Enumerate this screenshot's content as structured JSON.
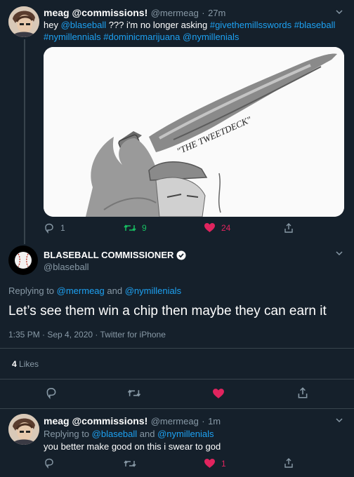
{
  "tweet1": {
    "name": "meag @commissions!",
    "handle": "@mermeag",
    "sep": "·",
    "time": "27m",
    "text_parts": [
      "hey ",
      "@blaseball",
      " ??? i'm no longer asking ",
      "#givethemillsswords",
      " ",
      "#blaseball",
      " ",
      "#nymillennials",
      " ",
      "#dominicmarijuana",
      " ",
      "@nymillenials"
    ],
    "image_caption": "\"THE TWEETDECK\"",
    "replies": "1",
    "retweets": "9",
    "likes": "24"
  },
  "main_tweet": {
    "name": "BLASEBALL COMMISSIONER",
    "handle": "@blaseball",
    "replying_prefix": "Replying to ",
    "replying_user1": "@mermeag",
    "replying_and": " and ",
    "replying_user2": "@nymillenials",
    "text": "Let’s see them win a chip then maybe they can earn it",
    "meta": "1:35 PM · Sep 4, 2020 · Twitter for iPhone",
    "likes_count": "4",
    "likes_label": " Likes"
  },
  "reply_tweet": {
    "name": "meag @commissions!",
    "handle": "@mermeag",
    "sep": "·",
    "time": "1m",
    "replying_prefix": "Replying to ",
    "replying_user1": "@blaseball",
    "replying_and": " and ",
    "replying_user2": "@nymillenials",
    "text": "you better make good on this i swear to god",
    "likes": "1"
  },
  "colors": {
    "background": "#15202b",
    "link": "#1da1f2",
    "muted": "#8899a6",
    "retweet": "#17bf63",
    "like": "#e0245e"
  }
}
